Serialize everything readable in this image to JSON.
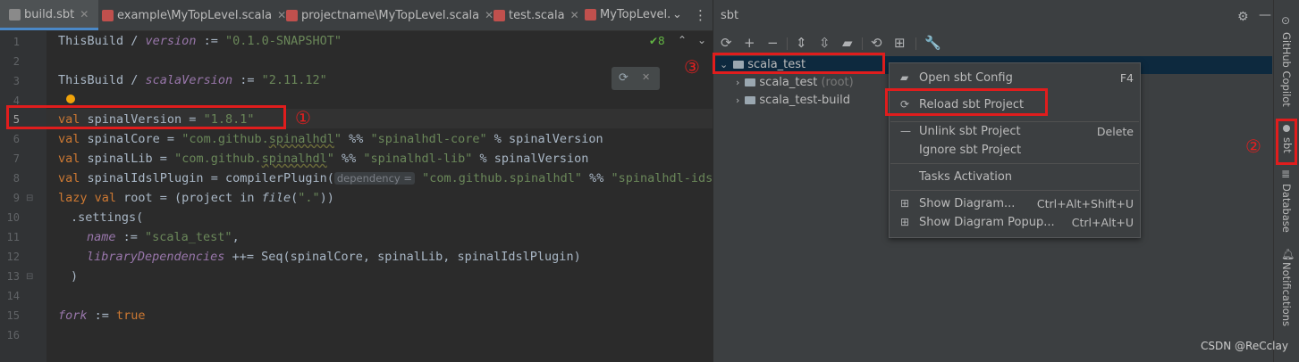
{
  "tabs": [
    {
      "label": "build.sbt",
      "icon": "sbt-file-icon",
      "active": true
    },
    {
      "label": "example\\MyTopLevel.scala",
      "icon": "scala-file-icon"
    },
    {
      "label": "projectname\\MyTopLevel.scala",
      "icon": "scala-file-icon"
    },
    {
      "label": "test.scala",
      "icon": "scala-file-icon"
    },
    {
      "label": "MyTopLevel.",
      "icon": "scala-file-icon"
    }
  ],
  "editor": {
    "inspection_count": "✔8",
    "line_numbers": [
      "1",
      "2",
      "3",
      "4",
      "5",
      "6",
      "7",
      "8",
      "9",
      "10",
      "11",
      "12",
      "13",
      "14",
      "15",
      "16"
    ],
    "lines": {
      "l1": {
        "a": "ThisBuild / ",
        "b": "version",
        "c": " := ",
        "d": "\"0.1.0-SNAPSHOT\""
      },
      "l3": {
        "a": "ThisBuild / ",
        "b": "scalaVersion",
        "c": " := ",
        "d": "\"2.11.12\""
      },
      "l5": {
        "kw": "val",
        "a": " spinalVersion = ",
        "s": "\"1.8.1\""
      },
      "l6": {
        "kw": "val",
        "a": " spinalCore = ",
        "s1": "\"com.github.",
        "u1": "spinalhdl",
        "s1b": "\"",
        "b": " %% ",
        "s2": "\"spinalhdl-core\"",
        "c": " % spinalVersion"
      },
      "l7": {
        "kw": "val",
        "a": " spinalLib = ",
        "s1": "\"com.github.",
        "u1": "spinalhdl",
        "s1b": "\"",
        "b": " %% ",
        "s2": "\"spinalhdl-lib\"",
        "c": " % spinalVersion"
      },
      "l8": {
        "kw": "val",
        "a": " spinalIdslPlugin = compilerPlugin(",
        "hint": "dependency =",
        "s1": "\"com.github.spinalhdl\"",
        "b": " %% ",
        "s2": "\"spinalhdl-idsl"
      },
      "l9": {
        "kw": "lazy val",
        "a": " root = (project in ",
        "f": "file",
        "b": "(",
        "s": "\".\"",
        "c": "))"
      },
      "l10": {
        "a": ".settings("
      },
      "l11": {
        "b": "name",
        "c": " := ",
        "s": "\"scala_test\"",
        "d": ","
      },
      "l12": {
        "b": "libraryDependencies",
        "c": " ++= Seq(spinalCore, spinalLib, spinalIdslPlugin)"
      },
      "l13": {
        "a": ")"
      },
      "l15": {
        "b": "fork",
        "c": " := ",
        "kw": "true"
      }
    }
  },
  "annotations": {
    "c1": "①",
    "c2": "②",
    "c3": "③"
  },
  "sbt": {
    "title": "sbt",
    "tree": [
      {
        "label": "scala_test",
        "selected": true
      },
      {
        "label": "scala_test",
        "suffix": "(root)"
      },
      {
        "label": "scala_test-build"
      }
    ]
  },
  "context_menu": [
    {
      "label": "Open sbt Config",
      "shortcut": "F4",
      "icon": "sbt-config-icon"
    },
    {
      "label": "Reload sbt Project",
      "shortcut": "",
      "icon": "reload-icon"
    },
    {
      "label": "Unlink sbt Project",
      "shortcut": "Delete",
      "icon": "minus-icon"
    },
    {
      "label": "Ignore sbt Project",
      "shortcut": ""
    },
    {
      "label": "Tasks Activation",
      "shortcut": ""
    },
    {
      "label": "Show Diagram...",
      "shortcut": "Ctrl+Alt+Shift+U",
      "icon": "diagram-icon"
    },
    {
      "label": "Show Diagram Popup...",
      "shortcut": "Ctrl+Alt+U",
      "icon": "diagram-icon"
    }
  ],
  "right_strip": [
    {
      "label": "GitHub Copilot",
      "icon": "copilot-icon"
    },
    {
      "label": "sbt",
      "icon": "sbt-icon"
    },
    {
      "label": "Database",
      "icon": "database-icon"
    },
    {
      "label": "Notifications",
      "icon": "bell-icon"
    }
  ],
  "watermark": "CSDN @ReCclay",
  "colors": {
    "highlight_red": "#e01d1d",
    "keyword": "#cc7832",
    "string": "#6a8759",
    "field": "#9876aa",
    "selection": "#0d293e"
  }
}
